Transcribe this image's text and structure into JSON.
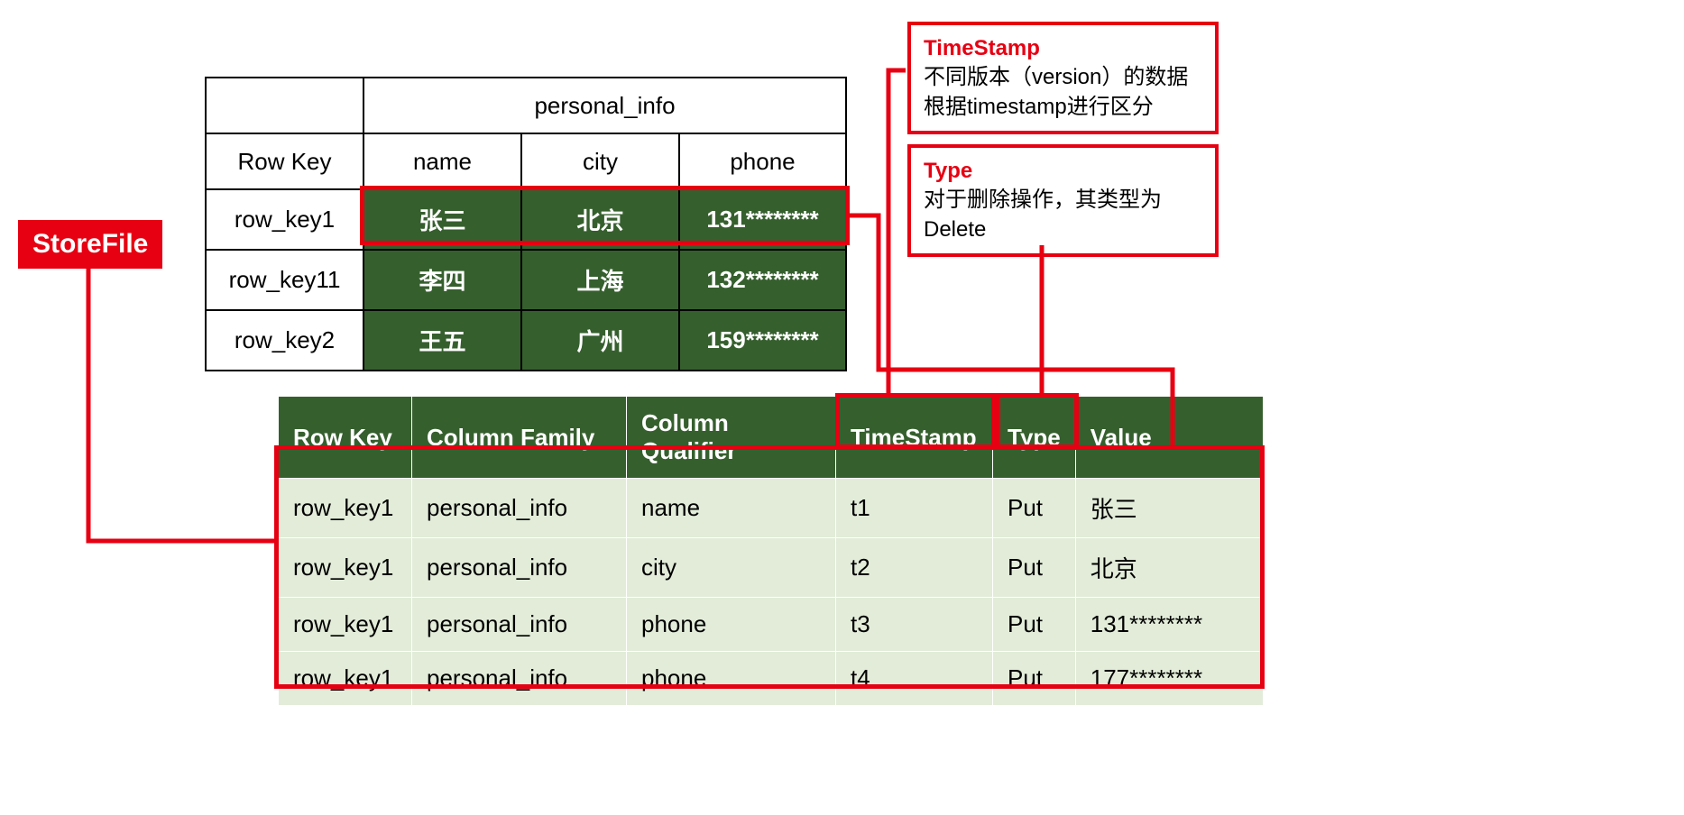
{
  "labels": {
    "storefile": "StoreFile"
  },
  "logical": {
    "cf_header": "personal_info",
    "rowkey_header": "Row Key",
    "columns": [
      "name",
      "city",
      "phone"
    ],
    "rows": [
      {
        "rk": "row_key1",
        "name": "张三",
        "city": "北京",
        "phone": "131********"
      },
      {
        "rk": "row_key11",
        "name": "李四",
        "city": "上海",
        "phone": "132********"
      },
      {
        "rk": "row_key2",
        "name": "王五",
        "city": "广州",
        "phone": "159********"
      }
    ]
  },
  "kv": {
    "headers": {
      "row_key": "Row Key",
      "cf": "Column Family",
      "cq": "Column Qualifier",
      "ts": "TimeStamp",
      "type": "Type",
      "value": "Value"
    },
    "rows": [
      {
        "rk": "row_key1",
        "cf": "personal_info",
        "cq": "name",
        "ts": "t1",
        "type": "Put",
        "value": "张三"
      },
      {
        "rk": "row_key1",
        "cf": "personal_info",
        "cq": "city",
        "ts": "t2",
        "type": "Put",
        "value": "北京"
      },
      {
        "rk": "row_key1",
        "cf": "personal_info",
        "cq": "phone",
        "ts": "t3",
        "type": "Put",
        "value": "131********"
      },
      {
        "rk": "row_key1",
        "cf": "personal_info",
        "cq": "phone",
        "ts": "t4",
        "type": "Put",
        "value": "177********"
      }
    ]
  },
  "callouts": {
    "timestamp": {
      "title": "TimeStamp",
      "body": "不同版本（version）的数据根据timestamp进行区分"
    },
    "type": {
      "title": "Type",
      "body": "对于删除操作，其类型为Delete"
    }
  }
}
